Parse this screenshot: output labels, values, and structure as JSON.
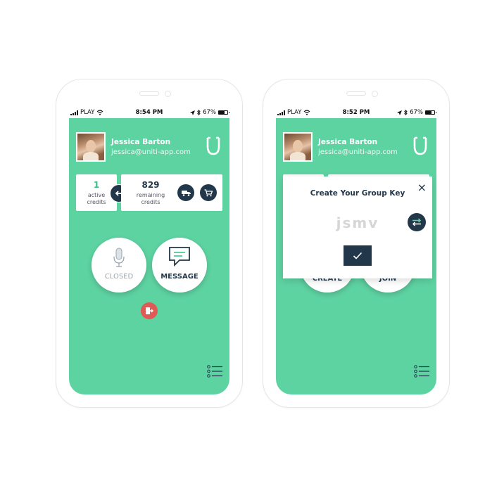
{
  "left_phone": {
    "status": {
      "carrier": "PLAY",
      "time": "8:54 PM",
      "battery": "67%"
    },
    "user": {
      "name": "Jessica Barton",
      "email": "jessica@uniti-app.com"
    },
    "credits": {
      "active_value": "1",
      "active_label_1": "active",
      "active_label_2": "credits",
      "remaining_value": "829",
      "remaining_label_1": "remaining",
      "remaining_label_2": "credits"
    },
    "buttons": {
      "closed": "CLOSED",
      "message": "MESSAGE"
    }
  },
  "right_phone": {
    "status": {
      "carrier": "PLAY",
      "time": "8:52 PM",
      "battery": "67%"
    },
    "user": {
      "name": "Jessica Barton",
      "email": "jessica@uniti-app.com"
    },
    "buttons": {
      "create": "CREATE",
      "join": "JOIN"
    },
    "modal": {
      "title": "Create Your Group Key",
      "key": "jsmv",
      "close": "×"
    }
  },
  "colors": {
    "screen": "#5ed3a2",
    "navy": "#22384a",
    "exit": "#e05a55"
  },
  "icons": [
    "signal-icon",
    "wifi-icon",
    "location-icon",
    "bluetooth-icon",
    "battery-icon",
    "logo-icon",
    "transfer-icon",
    "truck-icon",
    "cart-icon",
    "microphone-icon",
    "chat-icon",
    "exit-icon",
    "menu-list-icon",
    "close-icon",
    "swap-icon",
    "check-icon"
  ]
}
